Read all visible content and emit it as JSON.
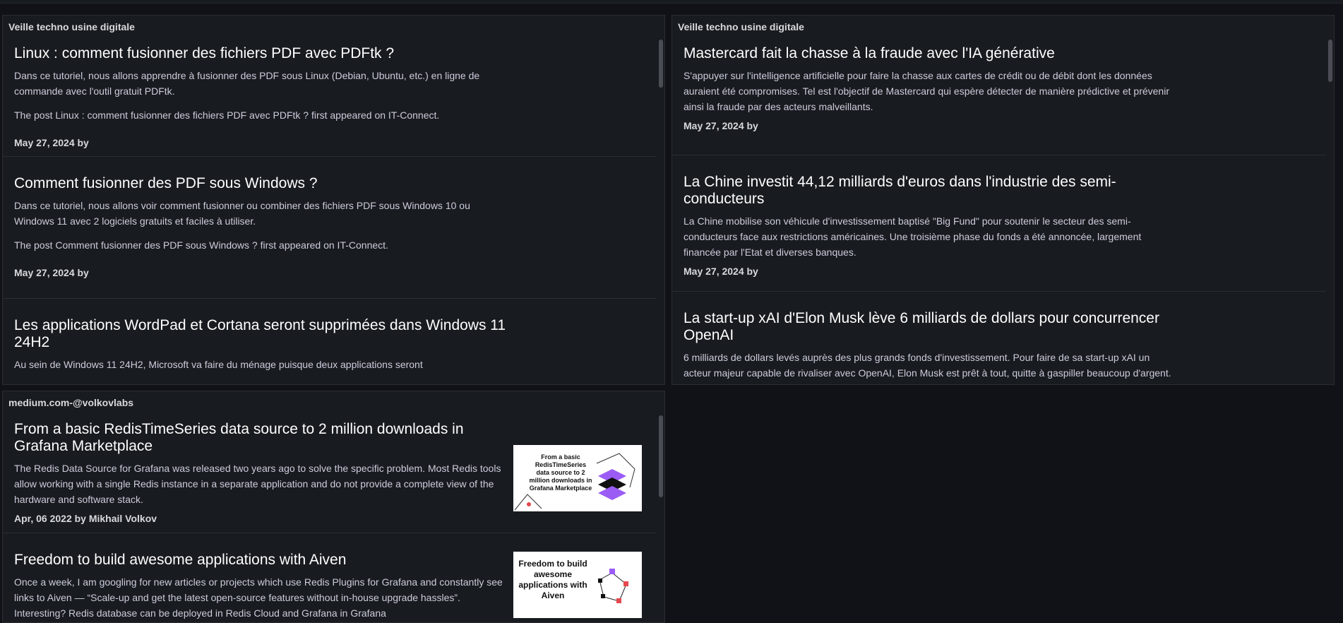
{
  "panels": {
    "veille1": {
      "title": "Veille techno usine digitale",
      "articles": [
        {
          "title": "Linux : comment fusionner des fichiers PDF avec PDFtk ?",
          "desc": "Dans ce tutoriel, nous allons apprendre à fusionner des PDF sous Linux (Debian, Ubuntu, etc.) en ligne de commande avec l'outil gratuit PDFtk.",
          "post": "The post Linux : comment fusionner des fichiers PDF avec PDFtk ? first appeared on IT-Connect.",
          "meta": "May 27, 2024 by"
        },
        {
          "title": "Comment fusionner des PDF sous Windows ?",
          "desc": "Dans ce tutoriel, nous allons voir comment fusionner ou combiner des fichiers PDF sous Windows 10 ou Windows 11 avec 2 logiciels gratuits et faciles à utiliser.",
          "post": "The post Comment fusionner des PDF sous Windows ? first appeared on IT-Connect.",
          "meta": "May 27, 2024 by"
        },
        {
          "title": "Les applications WordPad et Cortana seront supprimées dans Windows 11 24H2",
          "desc": "Au sein de Windows 11 24H2, Microsoft va faire du ménage puisque deux applications seront"
        }
      ]
    },
    "veille2": {
      "title": "Veille techno usine digitale",
      "articles": [
        {
          "title": "Mastercard fait la chasse à la fraude avec l'IA générative",
          "desc": "S'appuyer sur l'intelligence artificielle pour faire la chasse aux cartes de crédit ou de débit dont les données auraient été compromises. Tel est l'objectif de Mastercard qui espère détecter de manière prédictive et prévenir ainsi la fraude par des acteurs malveillants.",
          "meta": "May 27, 2024 by"
        },
        {
          "title": "La Chine investit 44,12 milliards d'euros dans l'industrie des semi-conducteurs",
          "desc": "La Chine mobilise son véhicule d'investissement baptisé \"Big Fund\" pour soutenir le secteur des semi-conducteurs face aux restrictions américaines. Une troisième phase du fonds a été annoncée, largement financée par l'Etat et diverses banques.",
          "meta": "May 27, 2024 by"
        },
        {
          "title": "La start-up xAI d'Elon Musk lève 6 milliards de dollars pour concurrencer OpenAI",
          "desc": "6 milliards de dollars levés auprès des plus grands fonds d'investissement. Pour faire de sa start-up xAI un acteur majeur capable de rivaliser avec OpenAI, Elon Musk est prêt à tout, quitte à gaspiller beaucoup d'argent."
        }
      ]
    },
    "medium": {
      "title": "medium.com-@volkovlabs",
      "articles": [
        {
          "title": "From a basic RedisTimeSeries data source to 2 million downloads in Grafana Marketplace",
          "desc": "The Redis Data Source for Grafana was released two years ago to solve the specific problem. Most Redis tools allow working with a single Redis instance in a separate application and do not provide a complete view of the hardware and software stack.",
          "meta": "Apr, 06 2022 by Mikhail Volkov",
          "thumb_text": "From a basic RedisTimeSeries data source to 2 million downloads in Grafana Marketplace",
          "thumb_accent": "#9b5cf6"
        },
        {
          "title": "Freedom to build awesome applications with Aiven",
          "desc": "Once a week, I am googling for new articles or projects which use Redis Plugins for Grafana and constantly see links to Aiven — “Scale-up and get the latest open-source features without in-house upgrade hassles”. Interesting? Redis database can be deployed in Redis Cloud and Grafana in Grafana",
          "thumb_text": "Freedom to build awesome applications with Aiven",
          "thumb_accent": "#e5484d"
        }
      ]
    }
  }
}
